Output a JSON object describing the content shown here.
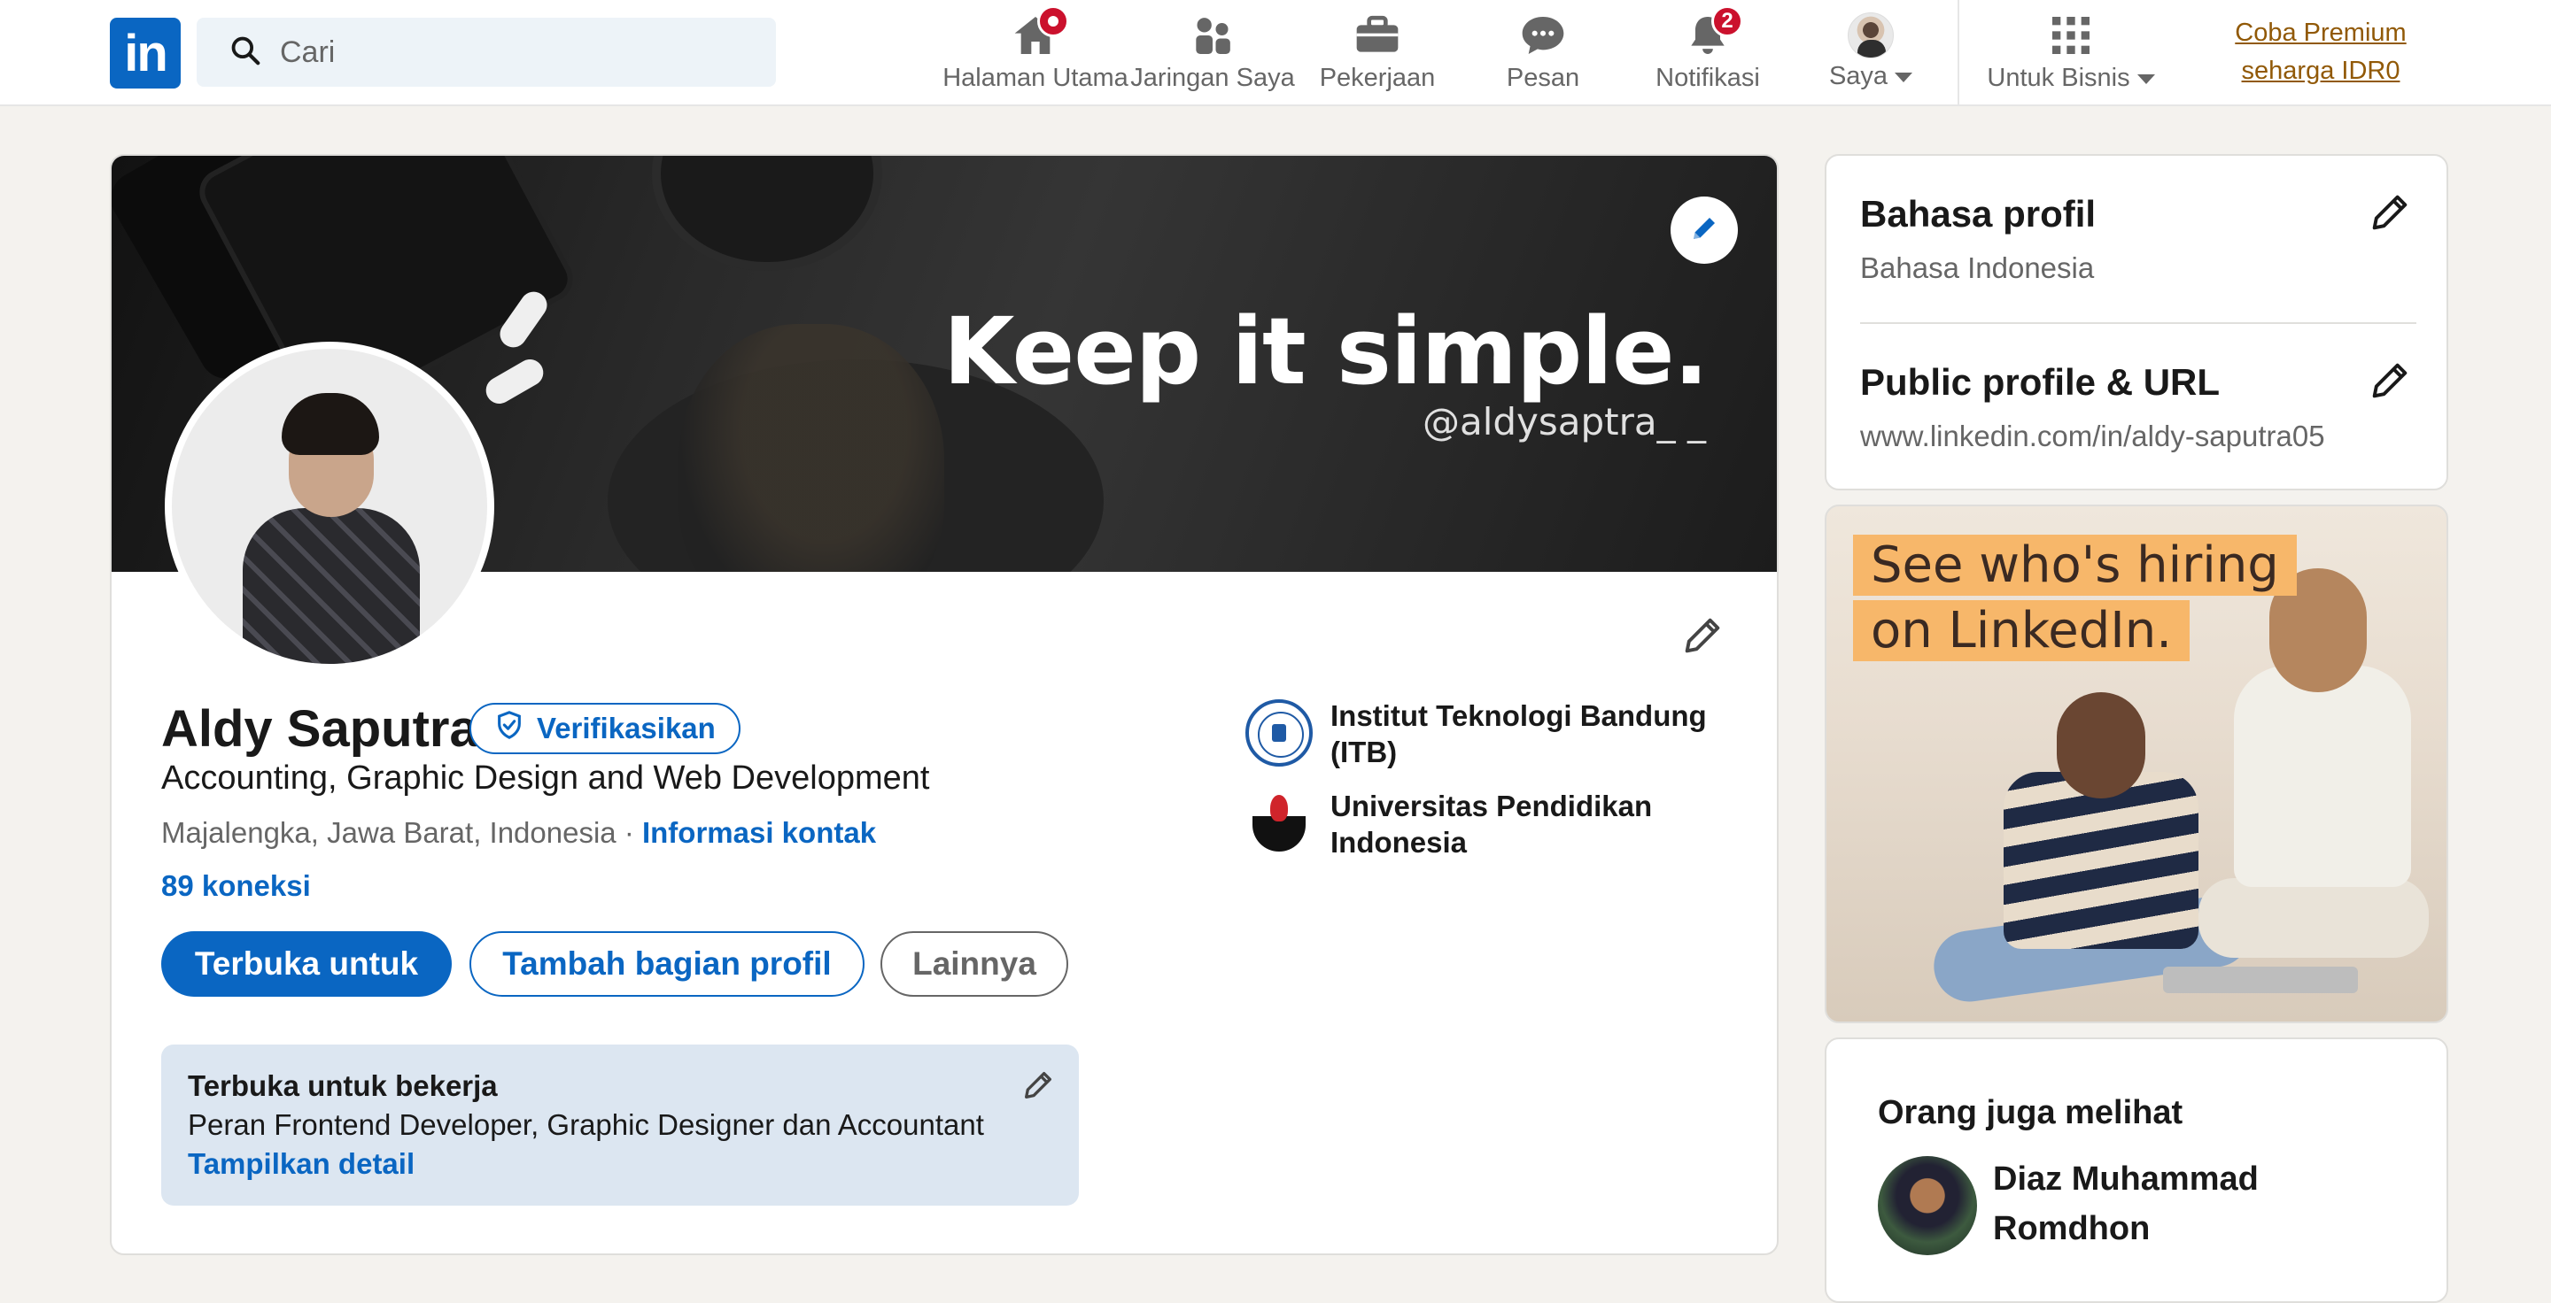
{
  "nav": {
    "logo_text": "in",
    "search_placeholder": "Cari",
    "items": [
      {
        "label": "Halaman Utama",
        "icon": "home-icon",
        "badge_dot": true
      },
      {
        "label": "Jaringan Saya",
        "icon": "people-icon"
      },
      {
        "label": "Pekerjaan",
        "icon": "briefcase-icon"
      },
      {
        "label": "Pesan",
        "icon": "message-icon"
      },
      {
        "label": "Notifikasi",
        "icon": "bell-icon",
        "badge": "2"
      },
      {
        "label": "Saya",
        "icon": "avatar"
      },
      {
        "label": "Untuk Bisnis",
        "icon": "grid-icon"
      }
    ],
    "premium_line1": "Coba Premium",
    "premium_line2": "seharga IDR0"
  },
  "profile": {
    "banner_title": "Keep it simple.",
    "banner_handle": "@aldysaptra_ _",
    "name": "Aldy Saputra",
    "verify_label": "Verifikasikan",
    "headline": "Accounting, Graphic Design and Web Development",
    "location": "Majalengka, Jawa Barat, Indonesia",
    "location_separator": " · ",
    "contact_info": "Informasi kontak",
    "connections": "89 koneksi",
    "buttons": {
      "open_to": "Terbuka untuk",
      "add_section": "Tambah bagian profil",
      "more": "Lainnya"
    },
    "education": [
      {
        "name": "Institut Teknologi Bandung (ITB)"
      },
      {
        "name": "Universitas Pendidikan Indonesia"
      }
    ],
    "open_to_work": {
      "title": "Terbuka untuk bekerja",
      "description": "Peran Frontend Developer, Graphic Designer dan Accountant",
      "link": "Tampilkan detail"
    }
  },
  "sidebar": {
    "language_title": "Bahasa profil",
    "language_value": "Bahasa Indonesia",
    "public_title": "Public profile & URL",
    "public_url": "www.linkedin.com/in/aldy-saputra05",
    "ad_line1": "See who's hiring",
    "ad_line2": "on LinkedIn.",
    "people_title": "Orang juga melihat",
    "people": [
      {
        "name": "Diaz Muhammad Romdhon"
      }
    ]
  },
  "colors": {
    "brand": "#0a66c2",
    "premium": "#915907",
    "notification": "#cb112d",
    "page_bg": "#f4f2ee",
    "open_box_bg": "#dce6f1"
  }
}
